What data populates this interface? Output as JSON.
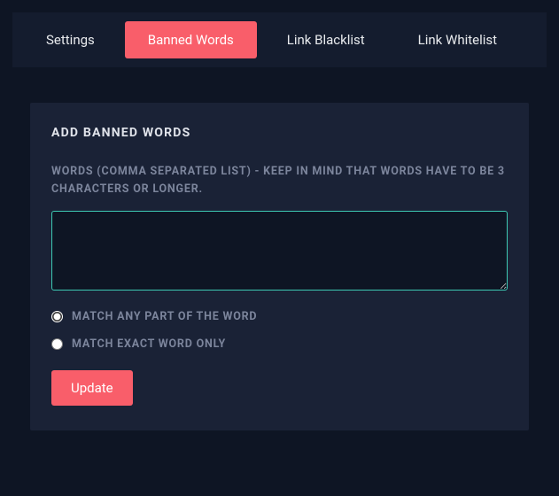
{
  "tabs": {
    "items": [
      {
        "label": "Settings",
        "active": false
      },
      {
        "label": "Banned Words",
        "active": true
      },
      {
        "label": "Link Blacklist",
        "active": false
      },
      {
        "label": "Link Whitelist",
        "active": false
      }
    ]
  },
  "panel": {
    "title": "Add Banned Words",
    "field_label": "Words (comma separated list) - Keep in mind that words have to be 3 characters or longer.",
    "textarea_value": "",
    "radios": {
      "match_any": {
        "label": "Match any part of the word",
        "checked": true
      },
      "match_exact": {
        "label": "Match exact word only",
        "checked": false
      }
    },
    "submit_label": "Update"
  }
}
